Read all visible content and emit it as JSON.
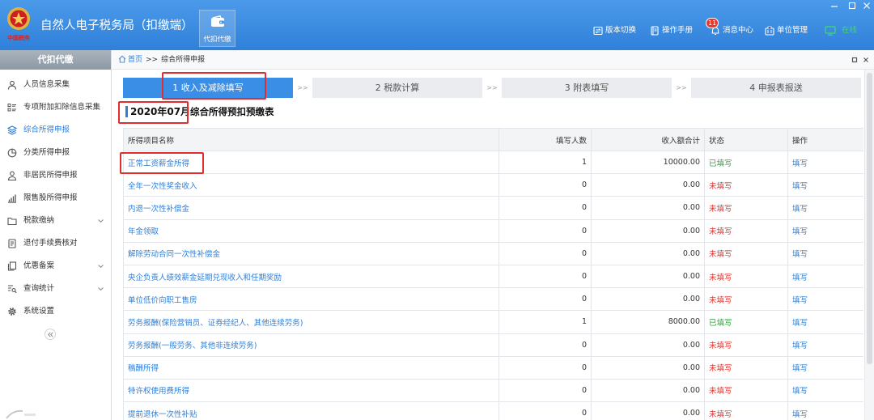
{
  "app": {
    "title": "自然人电子税务局（扣缴端）",
    "logo_text": "中国税务",
    "module_tab": {
      "label": "代扣代缴",
      "icon": "wallet-icon"
    }
  },
  "header_actions": [
    {
      "label": "版本切换",
      "icon": "version-switch-icon"
    },
    {
      "label": "操作手册",
      "icon": "manual-icon"
    },
    {
      "label": "消息中心",
      "icon": "message-icon",
      "badge": "11"
    },
    {
      "label": "单位管理",
      "icon": "unit-manage-icon"
    },
    {
      "label": "在线",
      "icon": "online-monitor-icon"
    }
  ],
  "sidebar": {
    "title": "代扣代缴",
    "active_index": 2,
    "items": [
      {
        "label": "人员信息采集",
        "icon": "person-icon"
      },
      {
        "label": "专项附加扣除信息采集",
        "icon": "list-icon"
      },
      {
        "label": "综合所得申报",
        "icon": "layers-icon"
      },
      {
        "label": "分类所得申报",
        "icon": "pie-chart-icon"
      },
      {
        "label": "非居民所得申报",
        "icon": "user-icon"
      },
      {
        "label": "限售股所得申报",
        "icon": "bar-chart-icon"
      },
      {
        "label": "税款缴纳",
        "icon": "folder-icon",
        "expandable": true
      },
      {
        "label": "退付手续费核对",
        "icon": "document-icon"
      },
      {
        "label": "优惠备案",
        "icon": "files-icon",
        "expandable": true
      },
      {
        "label": "查询统计",
        "icon": "search-list-icon",
        "expandable": true
      },
      {
        "label": "系统设置",
        "icon": "gear-icon"
      }
    ]
  },
  "breadcrumb": {
    "home": "首页",
    "separator": ">>",
    "current": "综合所得申报"
  },
  "steps": {
    "separator": ">>",
    "active_index": 0,
    "items": [
      {
        "label": "1 收入及减除填写"
      },
      {
        "label": "2 税款计算"
      },
      {
        "label": "3 附表填写"
      },
      {
        "label": "4 申报表报送"
      }
    ]
  },
  "report": {
    "period": "2020年07月",
    "title": "综合所得预扣预缴表"
  },
  "table": {
    "columns": [
      "所得项目名称",
      "填写人数",
      "收入额合计",
      "状态",
      "操作"
    ],
    "rows": [
      {
        "name": "正常工资薪金所得",
        "count": 1,
        "income": "10000.00",
        "status": "已填写",
        "action": "填写"
      },
      {
        "name": "全年一次性奖金收入",
        "count": 0,
        "income": "0.00",
        "status": "未填写",
        "action": "填写"
      },
      {
        "name": "内退一次性补偿金",
        "count": 0,
        "income": "0.00",
        "status": "未填写",
        "action": "填写"
      },
      {
        "name": "年金领取",
        "count": 0,
        "income": "0.00",
        "status": "未填写",
        "action": "填写"
      },
      {
        "name": "解除劳动合同一次性补偿金",
        "count": 0,
        "income": "0.00",
        "status": "未填写",
        "action": "填写"
      },
      {
        "name": "央企负责人绩效薪金延期兑现收入和任期奖励",
        "count": 0,
        "income": "0.00",
        "status": "未填写",
        "action": "填写"
      },
      {
        "name": "单位低价向职工售房",
        "count": 0,
        "income": "0.00",
        "status": "未填写",
        "action": "填写"
      },
      {
        "name": "劳务报酬(保险营销员、证券经纪人、其他连续劳务)",
        "count": 1,
        "income": "8000.00",
        "status": "已填写",
        "action": "填写"
      },
      {
        "name": "劳务报酬(一般劳务、其他非连续劳务)",
        "count": 0,
        "income": "0.00",
        "status": "未填写",
        "action": "填写"
      },
      {
        "name": "稿酬所得",
        "count": 0,
        "income": "0.00",
        "status": "未填写",
        "action": "填写"
      },
      {
        "name": "特许权使用费所得",
        "count": 0,
        "income": "0.00",
        "status": "未填写",
        "action": "填写"
      },
      {
        "name": "提前退休一次性补贴",
        "count": 0,
        "income": "0.00",
        "status": "未填写",
        "action": "填写"
      }
    ]
  },
  "colors": {
    "header_blue": "#2f80d9",
    "active_step": "#3a8ee6",
    "link": "#2f7fd6",
    "status_filled": "#2ea43c",
    "status_unfilled": "#e5322d",
    "highlight_box": "#e02d2d",
    "online": "#43d86e"
  }
}
